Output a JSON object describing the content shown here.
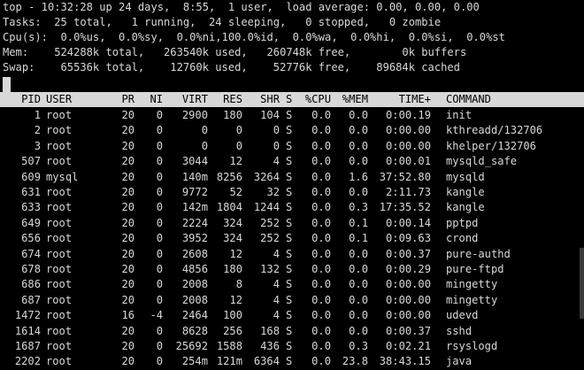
{
  "summary": {
    "top_line": "top - 10:32:28 up 24 days,  8:55,  1 user,  load average: 0.00, 0.00, 0.00",
    "tasks_line": "Tasks:  25 total,   1 running,  24 sleeping,   0 stopped,   0 zombie",
    "cpu_line": "Cpu(s):  0.0%us,  0.0%sy,  0.0%ni,100.0%id,  0.0%wa,  0.0%hi,  0.0%si,  0.0%st",
    "mem_line": "Mem:    524288k total,   263540k used,   260748k free,        0k buffers",
    "swap_line": "Swap:    65536k total,    12760k used,    52776k free,    89684k cached"
  },
  "columns": {
    "pid": "PID",
    "user": "USER",
    "pr": "PR",
    "ni": "NI",
    "virt": "VIRT",
    "res": "RES",
    "shr": "SHR",
    "s": "S",
    "cpu": "%CPU",
    "mem": "%MEM",
    "time": "TIME+",
    "command": "COMMAND"
  },
  "processes": [
    {
      "pid": "1",
      "user": "root",
      "pr": "20",
      "ni": "0",
      "virt": "2900",
      "res": "180",
      "shr": "104",
      "s": "S",
      "cpu": "0.0",
      "mem": "0.0",
      "time": "0:00.19",
      "command": "init"
    },
    {
      "pid": "2",
      "user": "root",
      "pr": "20",
      "ni": "0",
      "virt": "0",
      "res": "0",
      "shr": "0",
      "s": "S",
      "cpu": "0.0",
      "mem": "0.0",
      "time": "0:00.00",
      "command": "kthreadd/132706"
    },
    {
      "pid": "3",
      "user": "root",
      "pr": "20",
      "ni": "0",
      "virt": "0",
      "res": "0",
      "shr": "0",
      "s": "S",
      "cpu": "0.0",
      "mem": "0.0",
      "time": "0:00.00",
      "command": "khelper/132706"
    },
    {
      "pid": "507",
      "user": "root",
      "pr": "20",
      "ni": "0",
      "virt": "3044",
      "res": "12",
      "shr": "4",
      "s": "S",
      "cpu": "0.0",
      "mem": "0.0",
      "time": "0:00.01",
      "command": "mysqld_safe"
    },
    {
      "pid": "609",
      "user": "mysql",
      "pr": "20",
      "ni": "0",
      "virt": "140m",
      "res": "8256",
      "shr": "3264",
      "s": "S",
      "cpu": "0.0",
      "mem": "1.6",
      "time": "37:52.80",
      "command": "mysqld"
    },
    {
      "pid": "631",
      "user": "root",
      "pr": "20",
      "ni": "0",
      "virt": "9772",
      "res": "52",
      "shr": "32",
      "s": "S",
      "cpu": "0.0",
      "mem": "0.0",
      "time": "2:11.73",
      "command": "kangle"
    },
    {
      "pid": "633",
      "user": "root",
      "pr": "20",
      "ni": "0",
      "virt": "142m",
      "res": "1804",
      "shr": "1244",
      "s": "S",
      "cpu": "0.0",
      "mem": "0.3",
      "time": "17:35.52",
      "command": "kangle"
    },
    {
      "pid": "649",
      "user": "root",
      "pr": "20",
      "ni": "0",
      "virt": "2224",
      "res": "324",
      "shr": "252",
      "s": "S",
      "cpu": "0.0",
      "mem": "0.1",
      "time": "0:00.14",
      "command": "pptpd"
    },
    {
      "pid": "656",
      "user": "root",
      "pr": "20",
      "ni": "0",
      "virt": "3952",
      "res": "324",
      "shr": "252",
      "s": "S",
      "cpu": "0.0",
      "mem": "0.1",
      "time": "0:09.63",
      "command": "crond"
    },
    {
      "pid": "674",
      "user": "root",
      "pr": "20",
      "ni": "0",
      "virt": "2608",
      "res": "12",
      "shr": "4",
      "s": "S",
      "cpu": "0.0",
      "mem": "0.0",
      "time": "0:00.37",
      "command": "pure-authd"
    },
    {
      "pid": "678",
      "user": "root",
      "pr": "20",
      "ni": "0",
      "virt": "4856",
      "res": "180",
      "shr": "132",
      "s": "S",
      "cpu": "0.0",
      "mem": "0.0",
      "time": "0:00.29",
      "command": "pure-ftpd"
    },
    {
      "pid": "686",
      "user": "root",
      "pr": "20",
      "ni": "0",
      "virt": "2008",
      "res": "8",
      "shr": "4",
      "s": "S",
      "cpu": "0.0",
      "mem": "0.0",
      "time": "0:00.00",
      "command": "mingetty"
    },
    {
      "pid": "687",
      "user": "root",
      "pr": "20",
      "ni": "0",
      "virt": "2008",
      "res": "12",
      "shr": "4",
      "s": "S",
      "cpu": "0.0",
      "mem": "0.0",
      "time": "0:00.00",
      "command": "mingetty"
    },
    {
      "pid": "1472",
      "user": "root",
      "pr": "16",
      "ni": "-4",
      "virt": "2464",
      "res": "100",
      "shr": "4",
      "s": "S",
      "cpu": "0.0",
      "mem": "0.0",
      "time": "0:00.00",
      "command": "udevd"
    },
    {
      "pid": "1614",
      "user": "root",
      "pr": "20",
      "ni": "0",
      "virt": "8628",
      "res": "256",
      "shr": "168",
      "s": "S",
      "cpu": "0.0",
      "mem": "0.0",
      "time": "0:00.37",
      "command": "sshd"
    },
    {
      "pid": "1687",
      "user": "root",
      "pr": "20",
      "ni": "0",
      "virt": "25692",
      "res": "1588",
      "shr": "436",
      "s": "S",
      "cpu": "0.0",
      "mem": "0.3",
      "time": "0:02.21",
      "command": "rsyslogd"
    },
    {
      "pid": "2202",
      "user": "root",
      "pr": "20",
      "ni": "0",
      "virt": "254m",
      "res": "121m",
      "shr": "6364",
      "s": "S",
      "cpu": "0.0",
      "mem": "23.8",
      "time": "38:43.15",
      "command": "java"
    }
  ],
  "colors": {
    "background": "#000000",
    "foreground": "#d8d8d8",
    "header_background": "#d8d8d8",
    "header_text": "#000000"
  }
}
